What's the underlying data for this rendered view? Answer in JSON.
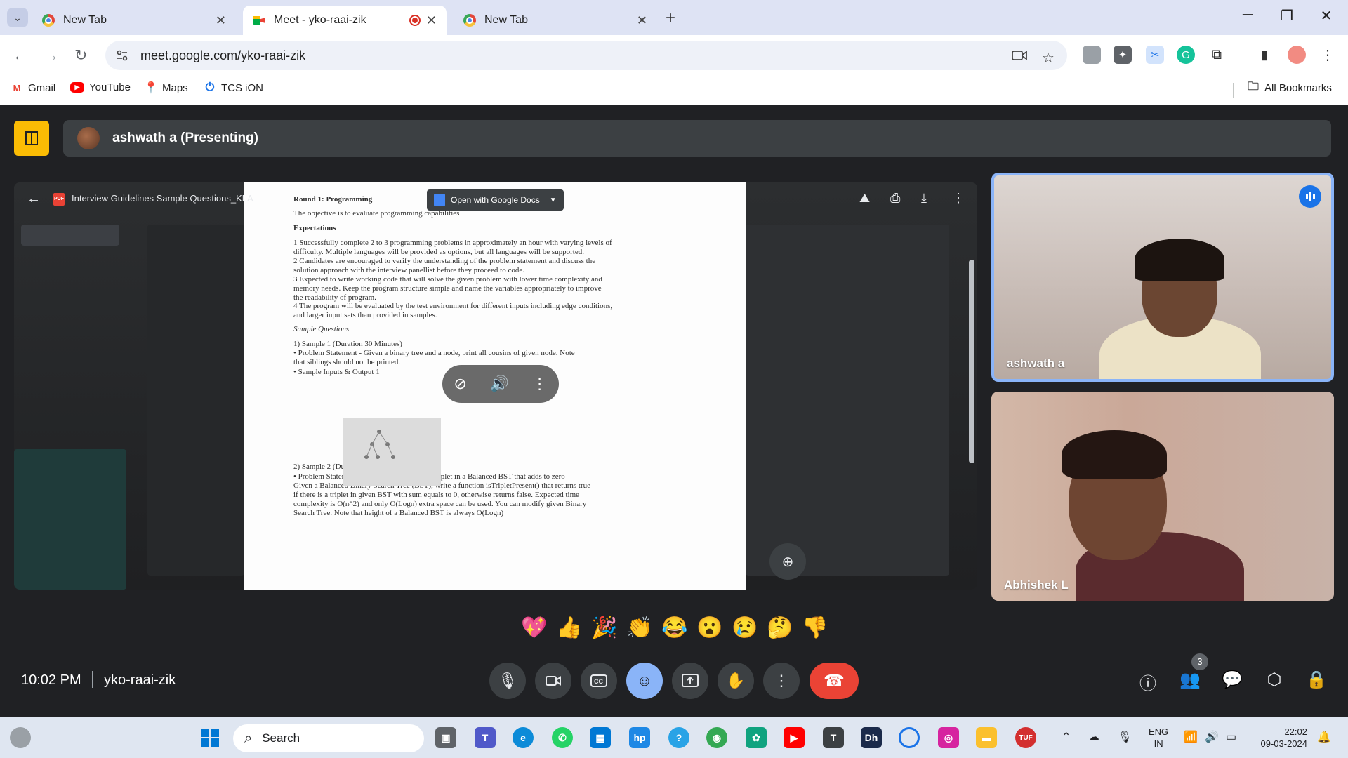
{
  "browser": {
    "tabs": [
      {
        "title": "New Tab",
        "active": false
      },
      {
        "title": "Meet - yko-raai-zik",
        "active": true,
        "recording": true
      },
      {
        "title": "New Tab",
        "active": false
      }
    ],
    "url": "meet.google.com/yko-raai-zik",
    "bookmarks": [
      {
        "label": "Gmail",
        "icon": "gmail-icon",
        "color": "#ea4335"
      },
      {
        "label": "YouTube",
        "icon": "youtube-icon",
        "color": "#ff0000"
      },
      {
        "label": "Maps",
        "icon": "maps-icon",
        "color": "#34a853"
      },
      {
        "label": "TCS iON",
        "icon": "tcs-ion-icon",
        "color": "#1a73e8"
      }
    ],
    "all_bookmarks_label": "All Bookmarks"
  },
  "meet": {
    "presenter_label": "ashwath a (Presenting)",
    "presentation": {
      "file_name": "Interview Guidelines Sample Questions_KLA",
      "open_with_label": "Open with Google Docs",
      "lines": [
        {
          "text": "Round 1: Programming",
          "style": "bold"
        },
        {
          "text": "The objective is to evaluate programming capabilities",
          "style": "normal"
        },
        {
          "text": "Expectations",
          "style": "bold"
        },
        {
          "text": "1   Successfully complete 2 to 3 programming problems in approximately an hour with varying levels of",
          "style": "normal"
        },
        {
          "text": "     difficulty. Multiple languages will be provided as options, but all languages will be supported.",
          "style": "normal"
        },
        {
          "text": "2   Candidates are encouraged to verify the understanding of the problem statement and discuss the",
          "style": "normal"
        },
        {
          "text": "     solution approach with the interview panellist before they proceed to code.",
          "style": "normal"
        },
        {
          "text": "3   Expected to write working code that will solve the given problem with lower time complexity and",
          "style": "normal"
        },
        {
          "text": "     memory needs. Keep the program structure simple and name the variables appropriately to improve",
          "style": "normal"
        },
        {
          "text": "     the readability of program.",
          "style": "normal"
        },
        {
          "text": "4   The program will be evaluated by the test environment for different inputs including edge conditions,",
          "style": "normal"
        },
        {
          "text": "     and larger input sets than provided in samples.",
          "style": "normal"
        },
        {
          "text": "Sample Questions",
          "style": "italic"
        },
        {
          "text": "1)   Sample 1 (Duration 30 Minutes)",
          "style": "normal"
        },
        {
          "text": "       •   Problem Statement - Given a binary tree and a node, print all cousins of given node. Note",
          "style": "normal"
        },
        {
          "text": "           that siblings should not be printed.",
          "style": "normal"
        },
        {
          "text": "       •   Sample Inputs & Output 1",
          "style": "normal"
        },
        {
          "text": "2)   Sample 2 (Duration 40 Minutes)",
          "style": "normal"
        },
        {
          "text": "       •   Problem Statement - Tree: Find if there is a triplet in a Balanced BST that adds to zero",
          "style": "normal"
        },
        {
          "text": "           Given a Balanced Binary Search Tree (BST), write a function isTripletPresent() that returns true",
          "style": "normal"
        },
        {
          "text": "           if there is a triplet in given BST with sum equals to 0, otherwise returns false. Expected time",
          "style": "normal"
        },
        {
          "text": "           complexity is O(n^2) and only O(Logn) extra space can be used. You can modify given Binary",
          "style": "normal"
        },
        {
          "text": "           Search Tree. Note that height of a Balanced BST is always O(Logn)",
          "style": "normal"
        }
      ]
    },
    "participants": [
      {
        "name": "ashwath a",
        "speaking": true
      },
      {
        "name": "Abhishek L",
        "speaking": false
      }
    ],
    "reactions": [
      "💖",
      "👍",
      "🎉",
      "👏",
      "😂",
      "😮",
      "😢",
      "🤔",
      "👎"
    ],
    "time": "10:02 PM",
    "meeting_code": "yko-raai-zik",
    "people_count": "3"
  },
  "taskbar": {
    "search_placeholder": "Search",
    "lang_line1": "ENG",
    "lang_line2": "IN",
    "clock_time": "22:02",
    "clock_date": "09-03-2024"
  },
  "colors": {
    "meet_bg": "#202124",
    "accent_blue": "#8ab4f8",
    "end_call_red": "#ea4335",
    "layout_yellow": "#fbbc04"
  }
}
